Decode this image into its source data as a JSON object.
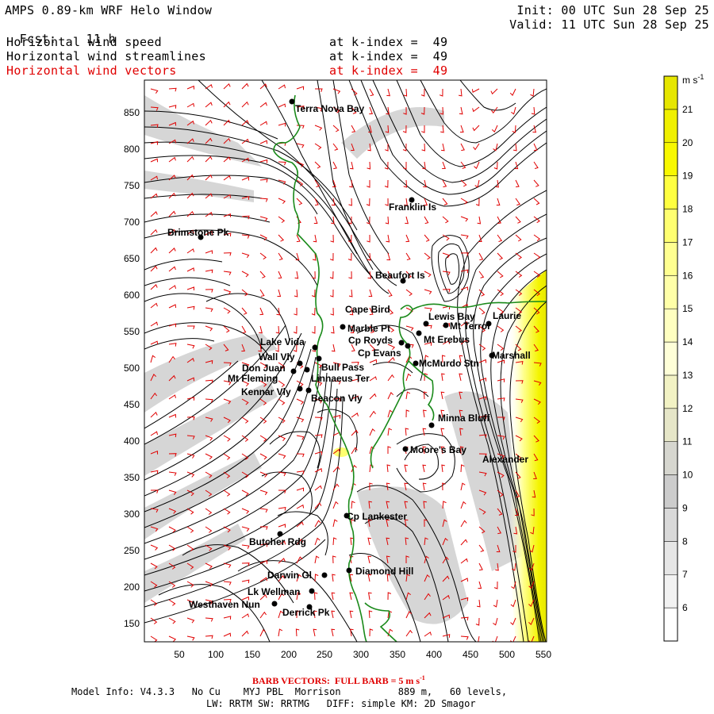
{
  "header": {
    "title": "AMPS 0.89-km WRF Helo Window",
    "fcst_label": "Fcst:",
    "fcst_value": "11 h",
    "init": "Init: 00 UTC Sun 28 Sep 25",
    "valid": "Valid: 11 UTC Sun 28 Sep 25",
    "fields": [
      {
        "name": "Horizontal wind speed",
        "level": "at k-index =  49",
        "color": "#000000"
      },
      {
        "name": "Horizontal wind streamlines",
        "level": "at k-index =  49",
        "color": "#000000"
      },
      {
        "name": "Horizontal wind vectors",
        "level": "at k-index =  49",
        "color": "#e00000"
      }
    ]
  },
  "map": {
    "x_ticks": [
      "50",
      "100",
      "150",
      "200",
      "250",
      "300",
      "350",
      "400",
      "450",
      "500",
      "550"
    ],
    "y_ticks": [
      "850",
      "800",
      "750",
      "700",
      "650",
      "600",
      "550",
      "500",
      "450",
      "400",
      "350",
      "300",
      "250",
      "200",
      "150"
    ],
    "places": [
      {
        "name": "Terra Nova Bay"
      },
      {
        "name": "Franklin Is"
      },
      {
        "name": "Brimstone Pk"
      },
      {
        "name": "Beaufort Is"
      },
      {
        "name": "Cape Bird"
      },
      {
        "name": "Marble Pt"
      },
      {
        "name": "Cp Royds"
      },
      {
        "name": "Lewis Bay"
      },
      {
        "name": "Mt Terror"
      },
      {
        "name": "Laurie"
      },
      {
        "name": "Mt Erebus"
      },
      {
        "name": "Cp Evans"
      },
      {
        "name": "Lake Vida"
      },
      {
        "name": "Wall Vly"
      },
      {
        "name": "Bull Pass"
      },
      {
        "name": "Don Juan"
      },
      {
        "name": "McMurdo Stn"
      },
      {
        "name": "Linnaeus Ter"
      },
      {
        "name": "Mt Fleming"
      },
      {
        "name": "Kennar Vly"
      },
      {
        "name": "Beacon Vly"
      },
      {
        "name": "Marshall"
      },
      {
        "name": "Minna Bluff"
      },
      {
        "name": "Moore's Bay"
      },
      {
        "name": "Alexander"
      },
      {
        "name": "Cp Lankester"
      },
      {
        "name": "Butcher Rdg"
      },
      {
        "name": "Darwin Gl"
      },
      {
        "name": "Diamond Hill"
      },
      {
        "name": "Lk Wellman"
      },
      {
        "name": "Westhaven Nun"
      },
      {
        "name": "Derrick Pk"
      }
    ]
  },
  "colorbar": {
    "unit": "m s",
    "unit_exp": "-1",
    "levels": [
      6,
      7,
      8,
      9,
      10,
      11,
      12,
      13,
      14,
      15,
      16,
      17,
      18,
      19,
      20,
      21
    ],
    "colors": [
      "#ffffff",
      "#f2f2f2",
      "#e6e6e6",
      "#d9d9d9",
      "#cccccc",
      "#d6d6cf",
      "#e6e6c8",
      "#f2f2c4",
      "#ffffd8",
      "#ffffc0",
      "#ffffa8",
      "#ffff90",
      "#ffff70",
      "#ffff40",
      "#f8f800",
      "#f0f000",
      "#e6e600"
    ]
  },
  "footer": {
    "barb_label": "BARB VECTORS:  FULL BARB = 5 m s",
    "barb_exp": "-1",
    "model_info_1": "Model Info: V4.3.3   No Cu    MYJ PBL  Morrison          889 m,   60 levels,",
    "model_info_2": "LW: RRTM SW: RRTMG   DIFF: simple KM: 2D Smagor"
  },
  "colors": {
    "streamline": "#000000",
    "barb": "#e00000",
    "coast": "#1a8a1a",
    "shade": "#c8c8c8"
  }
}
